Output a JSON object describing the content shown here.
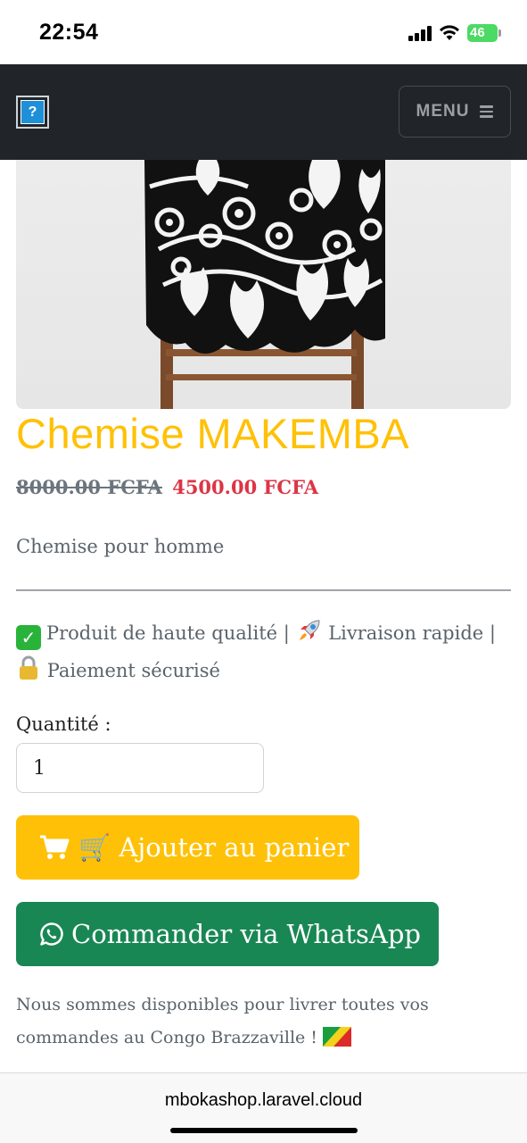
{
  "status_bar": {
    "time": "22:54",
    "battery": "46",
    "icons": [
      "signal-icon",
      "wifi-icon",
      "battery-charging-icon"
    ]
  },
  "navbar": {
    "logo_icon": "broken-image-icon",
    "logo_glyph": "?",
    "menu_label": "MENU",
    "menu_icon": "hamburger-icon",
    "background": "#212529"
  },
  "product": {
    "title": "Chemise MAKEMBA",
    "old_price": "8000.00 FCFA",
    "new_price": "4500.00 FCFA",
    "description": "Chemise pour homme",
    "features": {
      "quality": "Produit de haute qualité |",
      "delivery": "Livraison rapide |",
      "payment": "Paiement sécurisé"
    },
    "quantity_label": "Quantité :",
    "quantity_value": "1"
  },
  "actions": {
    "add_to_cart": "🛒 Ajouter au panier",
    "whatsapp": "Commander via WhatsApp"
  },
  "delivery_note": "Nous sommes disponibles pour livrer toutes vos commandes au Congo Brazzaville !",
  "browser": {
    "url": "mbokashop.laravel.cloud"
  },
  "colors": {
    "accent_yellow": "#ffc107",
    "price_red": "#dc3545",
    "whatsapp_green": "#198754"
  }
}
